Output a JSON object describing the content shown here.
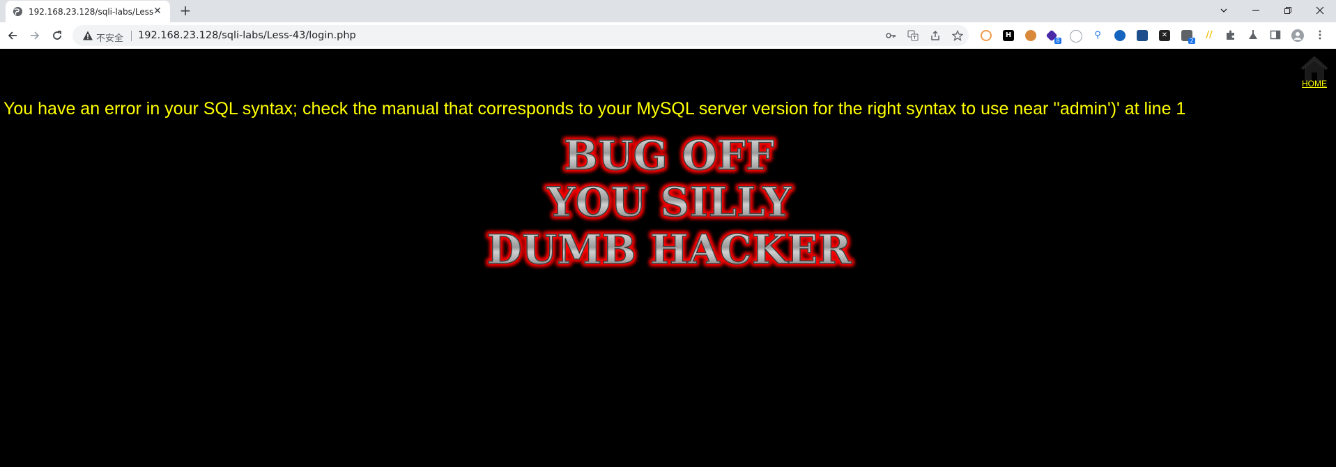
{
  "browser": {
    "tab_title": "192.168.23.128/sqli-labs/Less-",
    "new_tab_glyph": "+",
    "close_glyph": "✕",
    "security_label": "不安全",
    "url": "192.168.23.128/sqli-labs/Less-43/login.php",
    "extension_badges": [
      "8",
      "2"
    ]
  },
  "page": {
    "error_message": "You have an error in your SQL syntax; check the manual that corresponds to your MySQL server version for the right syntax to use near ''admin')' at line 1",
    "home_link": "HOME",
    "image_lines": [
      "BUG OFF",
      "YOU SILLY",
      "DUMB HACKER"
    ],
    "colors": {
      "background": "#000000",
      "error_text": "#ffff00",
      "image_glow": "#ff0000",
      "image_fill": "#c0c0c0"
    }
  }
}
